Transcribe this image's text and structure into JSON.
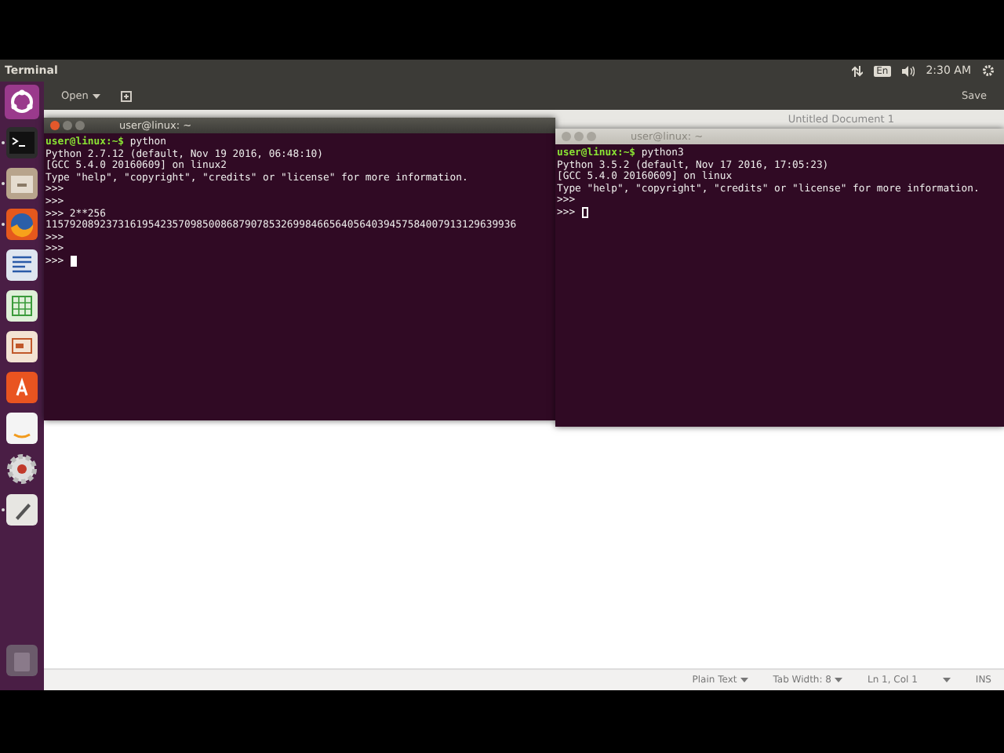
{
  "top_panel": {
    "app_title": "Terminal",
    "keyboard": "En",
    "clock": "2:30 AM"
  },
  "launcher": [
    {
      "kind": "ubuntu",
      "running": false
    },
    {
      "kind": "terminal",
      "running": true
    },
    {
      "kind": "files",
      "running": true
    },
    {
      "kind": "browser",
      "running": true
    },
    {
      "kind": "writer",
      "running": false
    },
    {
      "kind": "calc",
      "running": false
    },
    {
      "kind": "impress",
      "running": false
    },
    {
      "kind": "software",
      "running": false
    },
    {
      "kind": "shop",
      "running": false
    },
    {
      "kind": "settings",
      "running": false
    },
    {
      "kind": "editor",
      "running": true
    },
    {
      "kind": "trash",
      "running": false
    }
  ],
  "editor": {
    "open_button": "Open",
    "save_button": "Save",
    "title": "Untitled Document 1",
    "status_bar": {
      "language": "Plain Text",
      "tab_width": "Tab Width: 8",
      "position": "Ln 1, Col 1",
      "mode": "INS"
    }
  },
  "terminals": [
    {
      "title": "user@linux: ~",
      "focused": true,
      "lines": [
        {
          "kind": "prompt",
          "prompt": "user@linux:~$",
          "text": "python"
        },
        {
          "kind": "output",
          "text": "Python 2.7.12 (default, Nov 19 2016, 06:48:10)"
        },
        {
          "kind": "output",
          "text": "[GCC 5.4.0 20160609] on linux2"
        },
        {
          "kind": "output",
          "text": "Type \"help\", \"copyright\", \"credits\" or \"license\" for more information."
        },
        {
          "kind": "output",
          "text": ">>>"
        },
        {
          "kind": "output",
          "text": ">>>"
        },
        {
          "kind": "output",
          "text": ">>> 2**256"
        },
        {
          "kind": "output",
          "text": "115792089237316195423570985008687907853269984665640564039457584007913129639936"
        },
        {
          "kind": "output",
          "text": ">>>"
        },
        {
          "kind": "output",
          "text": ">>>"
        },
        {
          "kind": "input",
          "text": ">>>"
        }
      ]
    },
    {
      "title": "user@linux: ~",
      "focused": false,
      "lines": [
        {
          "kind": "prompt",
          "prompt": "user@linux:~$",
          "text": "python3"
        },
        {
          "kind": "output",
          "text": "Python 3.5.2 (default, Nov 17 2016, 17:05:23)"
        },
        {
          "kind": "output",
          "text": "[GCC 5.4.0 20160609] on linux"
        },
        {
          "kind": "output",
          "text": "Type \"help\", \"copyright\", \"credits\" or \"license\" for more information."
        },
        {
          "kind": "output",
          "text": ">>>"
        },
        {
          "kind": "input",
          "text": ">>>"
        }
      ]
    }
  ]
}
